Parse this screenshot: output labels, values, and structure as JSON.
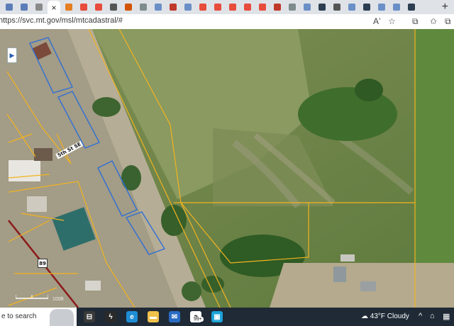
{
  "browser": {
    "tabs": [
      {
        "icon": "page-icon",
        "color": "#5b7db8"
      },
      {
        "icon": "page-icon",
        "color": "#5b7db8"
      },
      {
        "icon": "page-icon",
        "color": "#8a8a8a"
      },
      {
        "icon": "page-icon",
        "color": "#c0392b",
        "active": true
      },
      {
        "icon": "page-icon",
        "color": "#e67e22"
      },
      {
        "icon": "page-icon",
        "color": "#e74c3c"
      },
      {
        "icon": "page-icon",
        "color": "#e74c3c"
      },
      {
        "icon": "page-icon",
        "color": "#555555"
      },
      {
        "icon": "page-icon",
        "color": "#d35400"
      },
      {
        "icon": "page-icon",
        "color": "#7f8c8d"
      },
      {
        "icon": "search-icon",
        "color": "#6b8fc7"
      },
      {
        "icon": "page-icon",
        "color": "#c0392b"
      },
      {
        "icon": "search-icon",
        "color": "#6b8fc7"
      },
      {
        "icon": "page-icon",
        "color": "#e74c3c"
      },
      {
        "icon": "page-icon",
        "color": "#e74c3c"
      },
      {
        "icon": "page-icon",
        "color": "#e74c3c"
      },
      {
        "icon": "page-icon",
        "color": "#e74c3c"
      },
      {
        "icon": "page-icon",
        "color": "#e74c3c"
      },
      {
        "icon": "page-icon",
        "color": "#c0392b"
      },
      {
        "icon": "page-icon",
        "color": "#7f8c8d"
      },
      {
        "icon": "search-icon",
        "color": "#6b8fc7"
      },
      {
        "icon": "page-icon",
        "color": "#2c3e50"
      },
      {
        "icon": "page-icon",
        "color": "#555555"
      },
      {
        "icon": "search-icon",
        "color": "#6b8fc7"
      },
      {
        "icon": "page-icon",
        "color": "#2c3e50"
      },
      {
        "icon": "search-icon",
        "color": "#6b8fc7"
      },
      {
        "icon": "search-icon",
        "color": "#6b8fc7"
      },
      {
        "icon": "page-icon",
        "color": "#2c3e50"
      }
    ],
    "close_tab_glyph": "×",
    "new_tab_glyph": "+",
    "url": "https://svc.mt.gov/msl/mtcadastral/#",
    "toolbar": {
      "read_aloud": "Aʼ",
      "favorite": "☆",
      "split": "⧉",
      "favorites": "✩",
      "collections": "⧉"
    }
  },
  "map": {
    "street_label": "5th St SE",
    "highway_shield": "89",
    "scale_label": "100ft",
    "colors": {
      "parcel_line": "#f2b320",
      "selected_parcel": "#2f6fd6",
      "highway_line": "#8b1a1a"
    }
  },
  "taskbar": {
    "search_text": "e to search",
    "weather_temp": "43°F",
    "weather_desc": "Cloudy",
    "badge": "99+",
    "apps": [
      {
        "name": "file-explorer-icon",
        "color": "#3a3a3a",
        "glyph": "⊟"
      },
      {
        "name": "winamp-icon",
        "color": "#2a2a2a",
        "glyph": "ϟ"
      },
      {
        "name": "edge-icon",
        "color": "#1f8dd6",
        "glyph": "e"
      },
      {
        "name": "folder-icon",
        "color": "#f0c14b",
        "glyph": "▬"
      },
      {
        "name": "mail-icon",
        "color": "#2a6cc4",
        "glyph": "✉"
      },
      {
        "name": "amazon-icon",
        "color": "#ffffff",
        "glyph": "a"
      },
      {
        "name": "store-icon",
        "color": "#1aa3d6",
        "glyph": "▣"
      }
    ],
    "tray": {
      "chevron": "^",
      "network": "⌂",
      "notes": "▦"
    }
  }
}
